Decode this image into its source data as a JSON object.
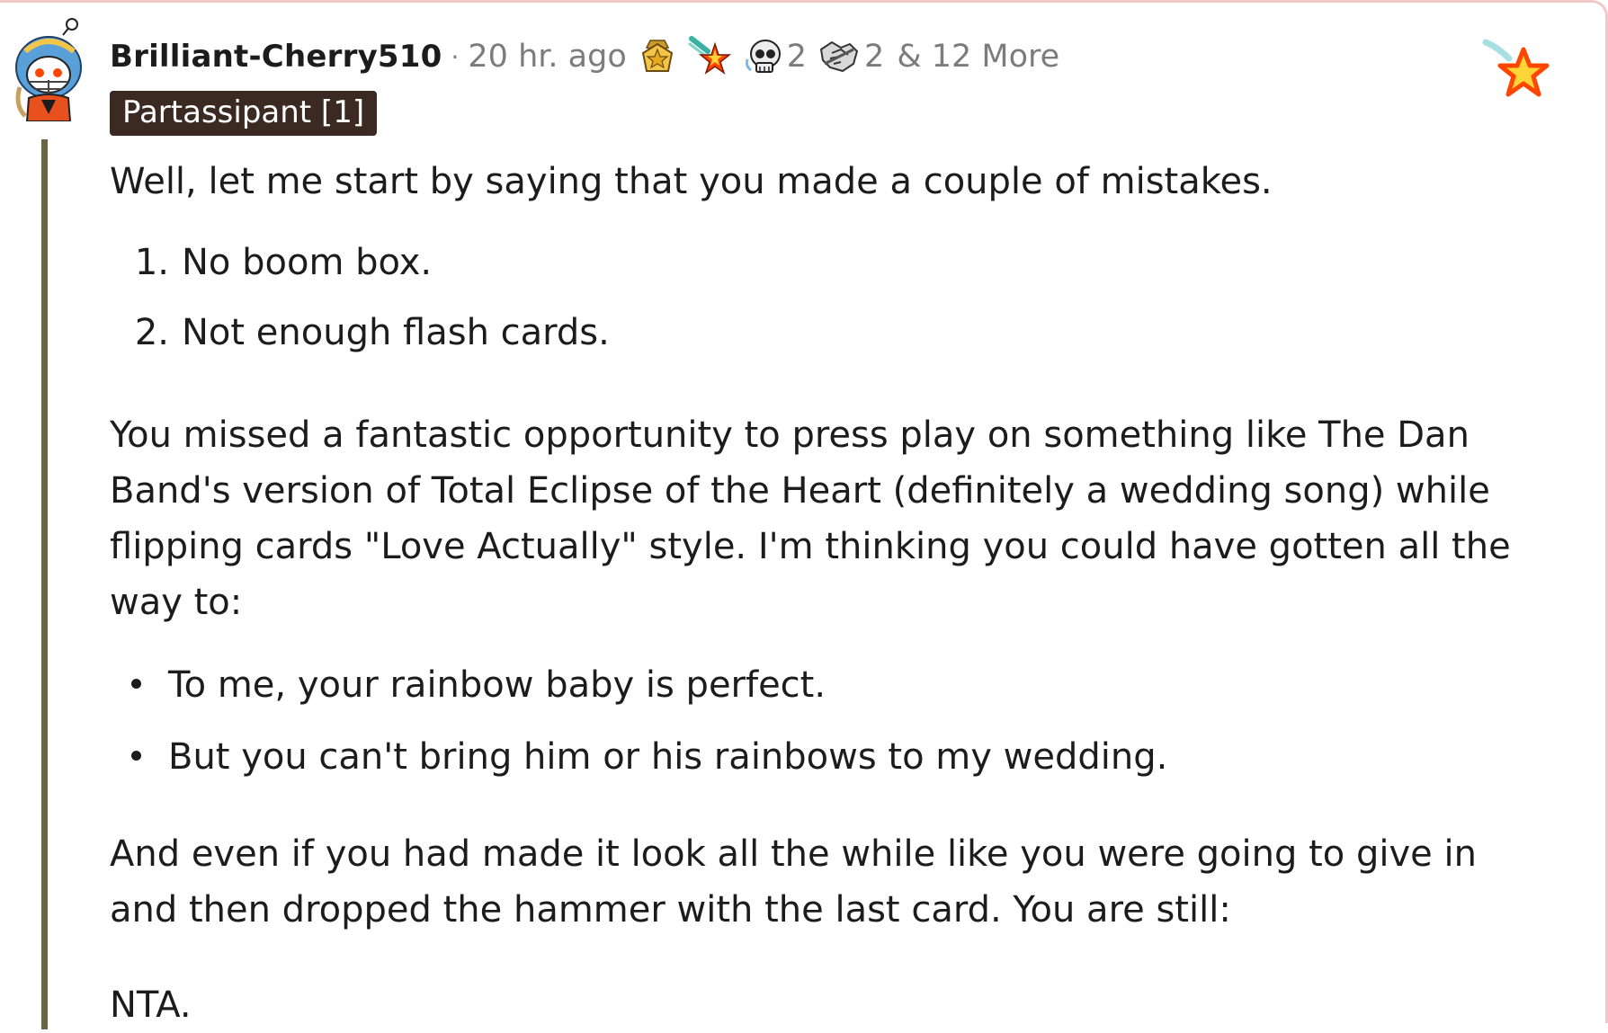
{
  "comment": {
    "username": "Brilliant-Cherry510",
    "separator": "·",
    "timestamp": "20 hr. ago",
    "awards": [
      {
        "icon": "gold-badge-icon"
      },
      {
        "icon": "rocket-star-icon"
      },
      {
        "icon": "skull-icon",
        "count": "2"
      },
      {
        "icon": "handshake-icon",
        "count": "2"
      }
    ],
    "more_awards": "& 12 More",
    "flair": "Partassipant [1]",
    "body": {
      "intro": "Well, let me start by saying that you made a couple of mistakes.",
      "ordered_list": [
        {
          "num": "1.",
          "text": "No boom box."
        },
        {
          "num": "2.",
          "text": "Not enough flash cards."
        }
      ],
      "paragraph2": "You missed a fantastic opportunity to press play on something like The Dan Band's version of Total Eclipse of the Heart (definitely a wedding song) while flipping cards \"Love Actually\" style. I'm thinking you could have gotten all the way to:",
      "bullet_list": [
        "To me, your rainbow baby is perfect.",
        "But you can't bring him or his rainbows to my wedding."
      ],
      "paragraph3": "And even if you had made it look all the while like you were going to give in and then dropped the hammer with the last card. You are still:",
      "verdict": "NTA."
    }
  },
  "colors": {
    "flair_bg": "#3a2a22",
    "thread_line": "#6b6546",
    "meta_text": "#7c7c7c",
    "star_fill": "#ffd635",
    "star_stroke": "#ff4500"
  }
}
